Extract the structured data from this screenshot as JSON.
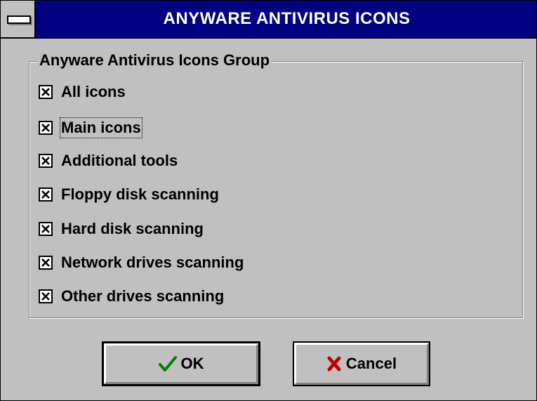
{
  "window": {
    "title": "ANYWARE ANTIVIRUS ICONS",
    "system_menu_icon": "system-menu-dash-icon"
  },
  "group": {
    "label": "Anyware Antivirus Icons Group",
    "options": [
      {
        "label": "All icons",
        "checked": true
      },
      {
        "label": "Main icons",
        "checked": true,
        "focused": true
      },
      {
        "label": "Additional tools",
        "checked": true
      },
      {
        "label": "Floppy disk scanning",
        "checked": true
      },
      {
        "label": "Hard disk scanning",
        "checked": true
      },
      {
        "label": "Network drives scanning",
        "checked": true
      },
      {
        "label": "Other drives scanning",
        "checked": true
      }
    ]
  },
  "buttons": {
    "ok_label": "OK",
    "ok_icon": "green-checkmark-icon",
    "cancel_label": "Cancel",
    "cancel_icon": "red-x-icon"
  },
  "colors": {
    "title_bar": "#000080",
    "face": "#c0c0c0",
    "check_green": "#008000",
    "cancel_red": "#c00000"
  }
}
